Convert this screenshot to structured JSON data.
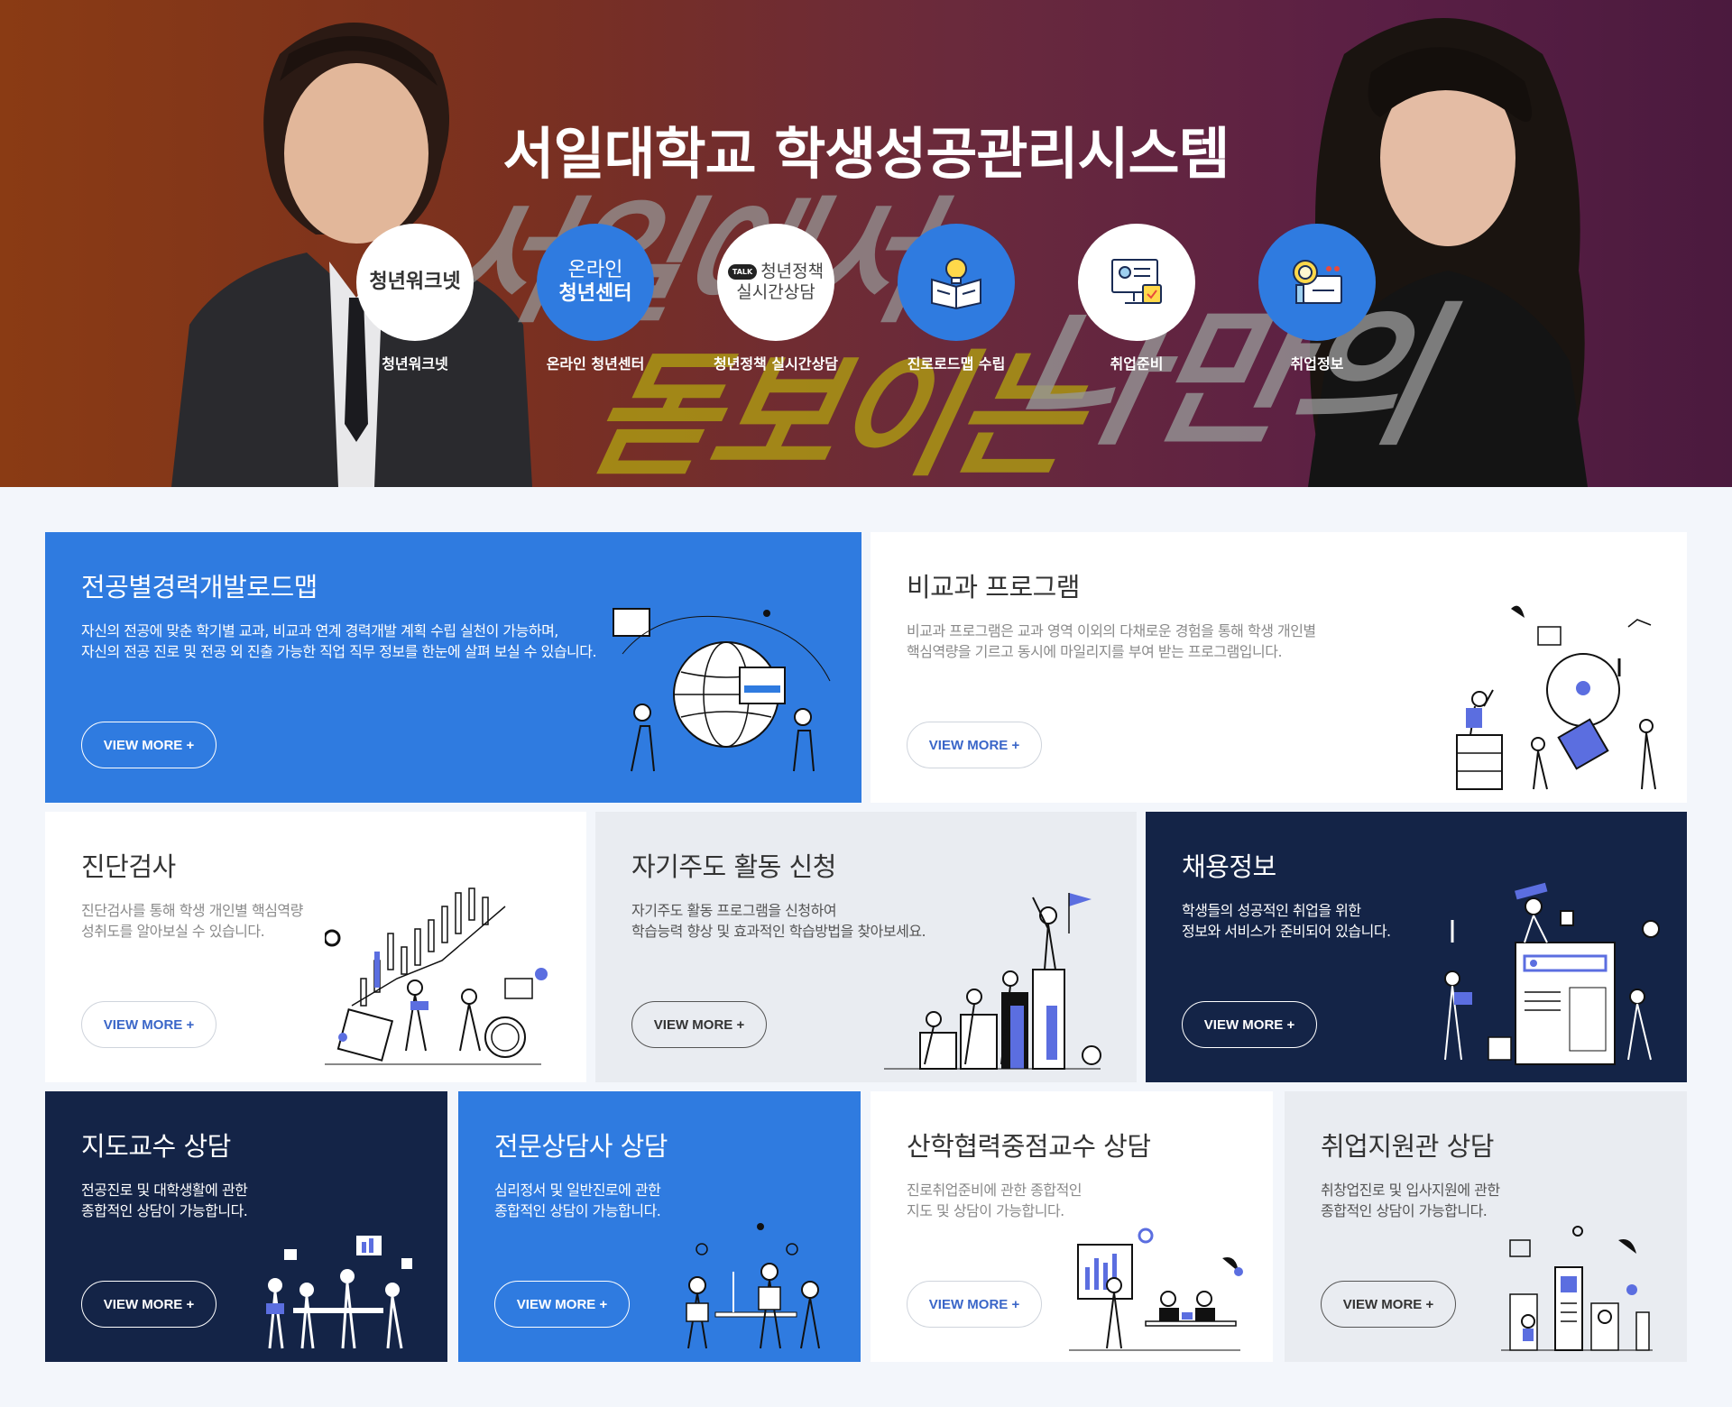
{
  "hero": {
    "title": "서일대학교 학생성공관리시스템",
    "slogan_line1": "서일에서",
    "slogan_line2": "돋보이는",
    "slogan_line3": "나만의",
    "quick_links": [
      {
        "logo": "청년워크넷",
        "label": "청년워크넷",
        "style": "white"
      },
      {
        "logo_line1": "온라인",
        "logo_line2": "청년센터",
        "label": "온라인 청년센터",
        "style": "blue"
      },
      {
        "logo_badge": "TALK",
        "logo_line1": "청년정책",
        "logo_line2": "실시간상담",
        "label": "청년정책 실시간상담",
        "style": "white"
      },
      {
        "label": "진로로드맵 수립",
        "icon": "book-bulb-icon",
        "style": "blue"
      },
      {
        "label": "취업준비",
        "icon": "monitor-calendar-icon",
        "style": "white"
      },
      {
        "label": "취업정보",
        "icon": "magnifier-document-icon",
        "style": "blue"
      }
    ]
  },
  "view_more": "VIEW MORE +",
  "cards": {
    "roadmap": {
      "title": "전공별경력개발로드맵",
      "desc1": "자신의 전공에 맞춘 학기별 교과, 비교과 연계 경력개발 계획 수립 실천이 가능하며,",
      "desc2": "자신의 전공 진로 및 전공 외 진출 가능한 직업 직무 정보를 한눈에 살펴 보실 수 있습니다."
    },
    "extracurricular": {
      "title": "비교과 프로그램",
      "desc1": "비교과 프로그램은 교과 영역 이외의 다채로운 경험을 통해 학생 개인별",
      "desc2": "핵심역량을 기르고 동시에 마일리지를 부여 받는 프로그램입니다."
    },
    "diagnosis": {
      "title": "진단검사",
      "desc1": "진단검사를 통해 학생 개인별 핵심역량",
      "desc2": "성취도를 알아보실 수 있습니다."
    },
    "self_directed": {
      "title": "자기주도 활동 신청",
      "desc1": "자기주도 활동 프로그램을 신청하여",
      "desc2": "학습능력 향상 및 효과적인 학습방법을 찾아보세요."
    },
    "recruit": {
      "title": "채용정보",
      "desc1": "학생들의 성공적인 취업을 위한",
      "desc2": "정보와 서비스가 준비되어 있습니다."
    },
    "advisor": {
      "title": "지도교수 상담",
      "desc1": "전공진로 및 대학생활에 관한",
      "desc2": "종합적인 상담이 가능합니다."
    },
    "counselor": {
      "title": "전문상담사 상담",
      "desc1": "심리정서 및 일반진로에 관한",
      "desc2": "종합적인 상담이 가능합니다."
    },
    "industry": {
      "title": "산학협력중점교수 상담",
      "desc1": "진로취업준비에 관한 종합적인",
      "desc2": "지도 및 상담이 가능합니다."
    },
    "job_support": {
      "title": "취업지원관 상담",
      "desc1": "취창업진로 및 입사지원에 관한",
      "desc2": "종합적인 상담이 가능합니다."
    }
  }
}
